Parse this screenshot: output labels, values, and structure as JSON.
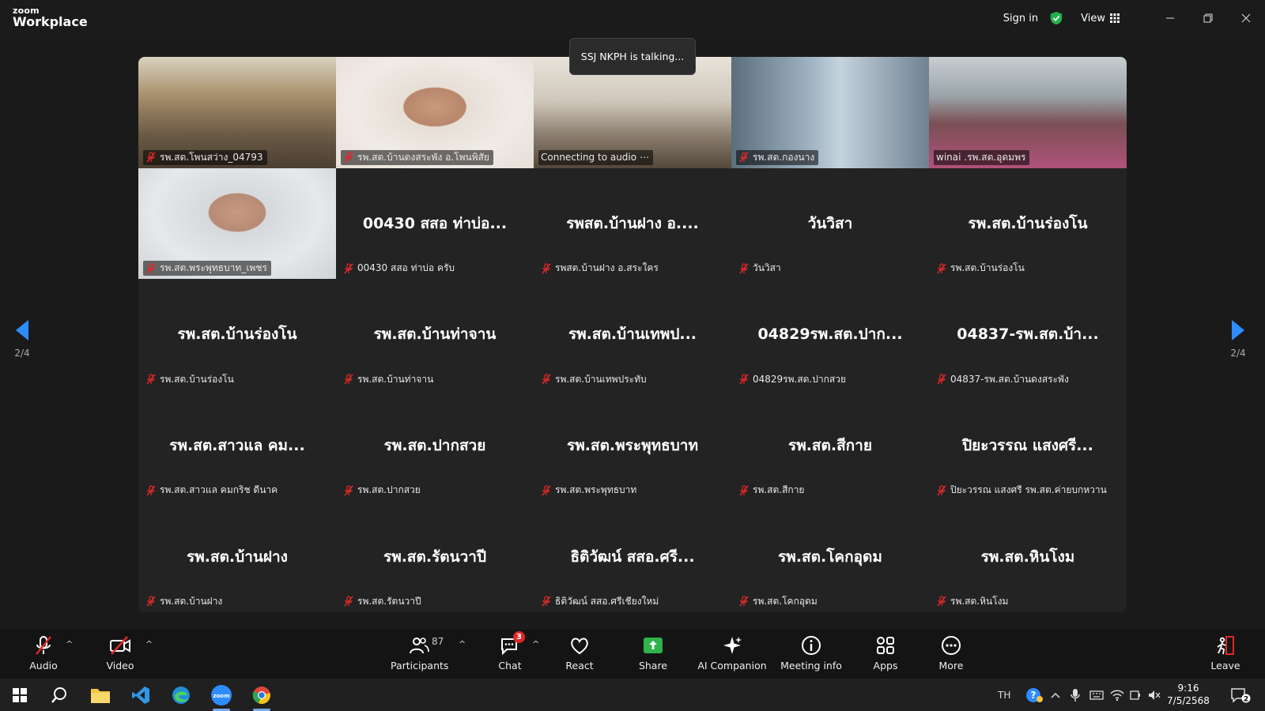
{
  "app": {
    "logo_line1": "zoom",
    "logo_line2": "Workplace"
  },
  "titlebar": {
    "sign_in": "Sign in",
    "view_label": "View",
    "shield_color": "#22b14c"
  },
  "toast": {
    "talking": "SSJ NKPH is talking..."
  },
  "tiles": [
    {
      "name": "รพ.สต.โพนสว่าง_04793",
      "video": true,
      "muted": true
    },
    {
      "name": "รพ.สต.บ้านดงสระพัง อ.โพนพิสัย",
      "video": true,
      "muted": true
    },
    {
      "name": "Connecting to audio",
      "video": true,
      "muted": false,
      "connecting": true
    },
    {
      "name": "รพ.สต.กองนาง",
      "video": true,
      "muted": true
    },
    {
      "name": "winai .รพ.สต.อุดมพร",
      "video": true,
      "muted": false
    },
    {
      "name": "รพ.สต.พระพุทธบาท_เพชร",
      "video": true,
      "muted": true
    },
    {
      "display": "00430 สสอ ท่าบ่อ...",
      "name": "00430 สสอ ท่าบ่อ ครับ",
      "muted": true
    },
    {
      "display": "รพสต.บ้านฝาง อ....",
      "name": "รพสต.บ้านฝาง อ.สระใคร",
      "muted": true
    },
    {
      "display": "วันวิสา",
      "name": "วันวิสา",
      "muted": true
    },
    {
      "display": "รพ.สต.บ้านร่องโน",
      "name": "รพ.สต.บ้านร่องโน",
      "muted": true
    },
    {
      "display": "รพ.สต.บ้านร่องโน",
      "name": "รพ.สต.บ้านร่องโน",
      "muted": true
    },
    {
      "display": "รพ.สต.บ้านท่าจาน",
      "name": "รพ.สต.บ้านท่าจาน",
      "muted": true
    },
    {
      "display": "รพ.สต.บ้านเทพป...",
      "name": "รพ.สต.บ้านเทพประทับ",
      "muted": true
    },
    {
      "display": "04829รพ.สต.ปาก...",
      "name": "04829รพ.สต.ปากสวย",
      "muted": true
    },
    {
      "display": "04837-รพ.สต.บ้า...",
      "name": "04837-รพ.สต.บ้านดงสระพัง",
      "muted": true
    },
    {
      "display": "รพ.สต.สาวแล คม...",
      "name": "รพ.สต.สาวแล คมกริช ดีนาค",
      "muted": true
    },
    {
      "display": "รพ.สต.ปากสวย",
      "name": "รพ.สต.ปากสวย",
      "muted": true
    },
    {
      "display": "รพ.สต.พระพุทธบาท",
      "name": "รพ.สต.พระพุทธบาท",
      "muted": true
    },
    {
      "display": "รพ.สต.สีกาย",
      "name": "รพ.สต.สีกาย",
      "muted": true
    },
    {
      "display": "ปิยะวรรณ แสงศรี...",
      "name": "ปิยะวรรณ แสงศรี รพ.สต.ค่ายบกหวาน",
      "muted": true
    },
    {
      "display": "รพ.สต.บ้านฝาง",
      "name": "รพ.สต.บ้านฝาง",
      "muted": true
    },
    {
      "display": "รพ.สต.รัตนวาปี",
      "name": "รพ.สต.รัตนวาปี",
      "muted": true
    },
    {
      "display": "ธิติวัฒน์ สสอ.ศรี...",
      "name": "ธิติวัฒน์ สสอ.ศรีเชียงใหม่",
      "muted": true
    },
    {
      "display": "รพ.สต.โคกอุดม",
      "name": "รพ.สต.โคกอุดม",
      "muted": true
    },
    {
      "display": "รพ.สต.หินโงม",
      "name": "รพ.สต.หินโงม",
      "muted": true
    }
  ],
  "pager": {
    "left": "2/4",
    "right": "2/4",
    "arrow_color": "#2d8cff"
  },
  "toolbar": {
    "audio": "Audio",
    "video": "Video",
    "participants": "Participants",
    "participants_count": "87",
    "chat": "Chat",
    "chat_badge": "3",
    "react": "React",
    "share": "Share",
    "ai_companion": "AI Companion",
    "meeting_info": "Meeting info",
    "apps": "Apps",
    "more": "More",
    "leave": "Leave",
    "share_color": "#2fb34a",
    "leave_color": "#e02828"
  },
  "taskbar": {
    "lang": "TH",
    "time": "9:16",
    "date": "7/5/2568",
    "notif": "2"
  }
}
